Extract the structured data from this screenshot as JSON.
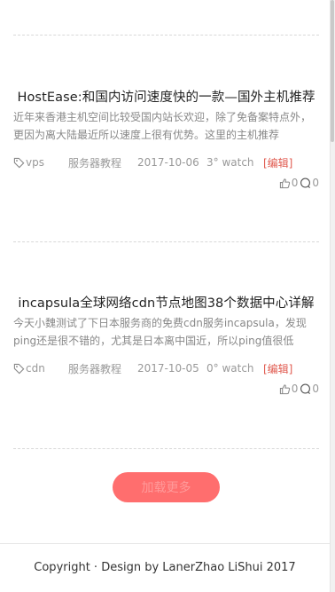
{
  "posts": [
    {
      "title": "HostEase:和国内访问速度快的一款—国外主机推荐",
      "excerpt": "近年来香港主机空间比较受国内站长欢迎，除了免备案特点外，更因为离大陆最近所以速度上很有优势。这里的主机推荐",
      "tag": "vps",
      "category": "服务器教程",
      "date": "2017-10-06",
      "watch": "3° watch",
      "edit": "[编辑]",
      "likes": "0",
      "comments": "0"
    },
    {
      "title": "incapsula全球网络cdn节点地图38个数据中心详解",
      "excerpt": "今天小魏测试了下日本服务商的免费cdn服务incapsula，发现ping还是很不错的，尤其是日本离中国近，所以ping值很低",
      "tag": "cdn",
      "category": "服务器教程",
      "date": "2017-10-05",
      "watch": "0° watch",
      "edit": "[编辑]",
      "likes": "0",
      "comments": "0"
    }
  ],
  "load_more_label": "加载更多",
  "footer_text": "Copyright  · Design by LanerZhao LiShui 2017",
  "colors": {
    "accent": "#ff6e6e",
    "edit": "#e05a4f"
  }
}
